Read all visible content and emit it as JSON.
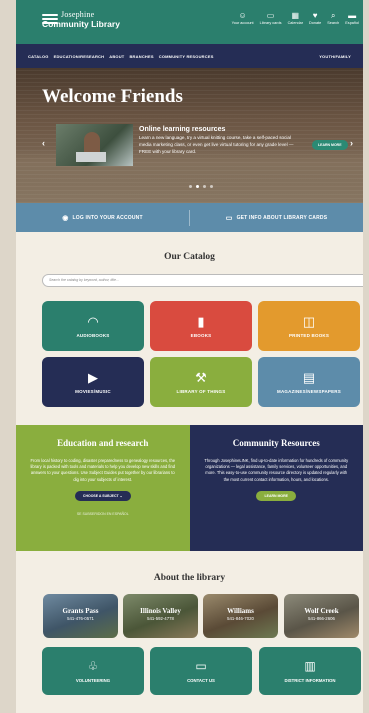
{
  "header": {
    "logo_line1": "Josephine",
    "logo_line2": "Community Library",
    "utilities": [
      {
        "icon": "user-icon",
        "glyph": "☺",
        "label": "Your account"
      },
      {
        "icon": "card-icon",
        "glyph": "▭",
        "label": "Library cards"
      },
      {
        "icon": "calendar-icon",
        "glyph": "▦",
        "label": "Calendar"
      },
      {
        "icon": "heart-icon",
        "glyph": "♥",
        "label": "Donate"
      },
      {
        "icon": "search-icon",
        "glyph": "⌕",
        "label": "Search"
      },
      {
        "icon": "speech-icon",
        "glyph": "▬",
        "label": "Español"
      }
    ]
  },
  "nav": {
    "items": [
      "CATALOG",
      "EDUCATION/RESEARCH",
      "ABOUT",
      "BRANCHES",
      "COMMUNITY RESOURCES"
    ],
    "right": "YOUTH/FAMILY"
  },
  "hero": {
    "title": "Welcome Friends",
    "slide_title": "Online learning resources",
    "slide_text": "Learn a new language, try a virtual knitting course, take a self-paced social media marketing class, or even get live virtual tutoring for any grade level — FREE with your library card.",
    "button": "LEARN MORE",
    "prev": "‹",
    "next": "›",
    "slides": 4,
    "active_slide": 2
  },
  "account_bar": {
    "login": "LOG INTO YOUR ACCOUNT",
    "cards": "GET INFO ABOUT LIBRARY CARDS"
  },
  "catalog": {
    "title": "Our Catalog",
    "search_placeholder": "Search the catalog by keyword, author, title...",
    "tiles": [
      {
        "label": "AUDIOBOOKS",
        "icon": "headphones-icon",
        "glyph": "🎧",
        "color": "#2b7f6d"
      },
      {
        "label": "EBOOKS",
        "icon": "tablet-icon",
        "glyph": "▮",
        "color": "#d94b3f"
      },
      {
        "label": "PRINTED BOOKS",
        "icon": "book-icon",
        "glyph": "📖",
        "color": "#e39a2d"
      },
      {
        "label": "MOVIES/MUSIC",
        "icon": "screen-icon",
        "glyph": "▶",
        "color": "#252d55"
      },
      {
        "label": "LIBRARY OF THINGS",
        "icon": "tools-icon",
        "glyph": "⚒",
        "color": "#8aae3e"
      },
      {
        "label": "MAGAZINES/NEWSPAPERS",
        "icon": "newspaper-icon",
        "glyph": "▤",
        "color": "#5d8caa"
      }
    ]
  },
  "education": {
    "title": "Education and research",
    "text": "From local history to coding, disaster preparedness to genealogy resources, the library is packed with tools and materials to help you develop new skills and find answers to your questions. Use Subject Guides put together by our librarians to dig into your subjects of interest.",
    "button": "CHOOSE A SUBJECT",
    "sub": "SE SUBSERIDON EN ESPAÑOL",
    "color": "#8aae3e"
  },
  "community": {
    "title": "Community Resources",
    "text": "Through JosephineLINK, find up-to-date information for hundreds of community organizations — legal assistance, family services, volunteer opportunities, and more. This easy-to-use community resource directory is updated regularly with the most current contact information, hours, and locations.",
    "button": "LEARN MORE",
    "color": "#252d55"
  },
  "about": {
    "title": "About the library",
    "branches": [
      {
        "name": "Grants Pass",
        "phone": "541-476-0571"
      },
      {
        "name": "Illinois Valley",
        "phone": "541-592-4778"
      },
      {
        "name": "Williams",
        "phone": "541-846-7020"
      },
      {
        "name": "Wolf Creek",
        "phone": "541-866-2606"
      }
    ],
    "actions": [
      {
        "label": "VOLUNTEERING",
        "icon": "volunteer-icon",
        "glyph": "♧"
      },
      {
        "label": "CONTACT US",
        "icon": "chat-icon",
        "glyph": "▭"
      },
      {
        "label": "DISTRICT INFORMATION",
        "icon": "buildings-icon",
        "glyph": "▥"
      }
    ]
  }
}
